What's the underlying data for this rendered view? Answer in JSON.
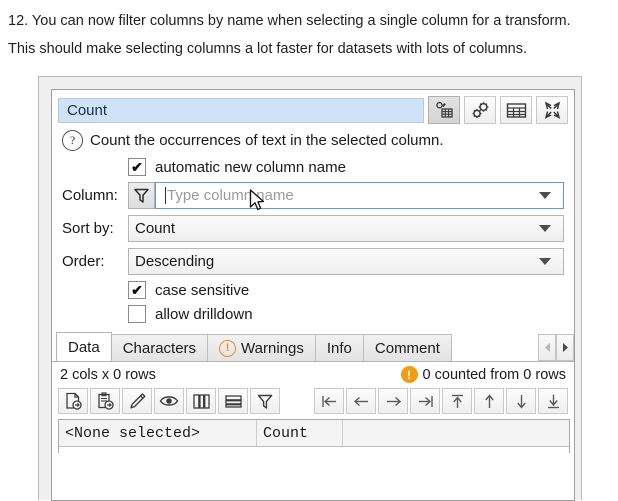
{
  "caption": {
    "line1": "12. You can now filter columns by name when selecting a single column for a transform.",
    "line2": "This should make selecting columns a lot faster for datasets with lots of columns."
  },
  "dialog": {
    "title": "Count",
    "toolbar": [
      {
        "name": "transform-settings-icon",
        "tooltip": "Transform settings",
        "pressed": true
      },
      {
        "name": "options-gears-icon",
        "tooltip": "Options",
        "pressed": false
      },
      {
        "name": "table-grid-icon",
        "tooltip": "Show table",
        "pressed": false
      },
      {
        "name": "expand-arrows-icon",
        "tooltip": "Maximize",
        "pressed": false
      }
    ],
    "description": "Count the occurrences of text in the selected column.",
    "help_icon": "?",
    "automatic_new_column_name": {
      "label": "automatic new column name",
      "checked": true,
      "check_glyph": "✔"
    },
    "column": {
      "label": "Column:",
      "filter_icon": "funnel-filter-icon",
      "placeholder": "Type column name",
      "value": ""
    },
    "sort_by": {
      "label": "Sort by:",
      "value": "Count"
    },
    "order": {
      "label": "Order:",
      "value": "Descending"
    },
    "case_sensitive": {
      "label": "case sensitive",
      "checked": true,
      "check_glyph": "✔"
    },
    "allow_drilldown": {
      "label": "allow drilldown",
      "checked": false,
      "check_glyph": ""
    },
    "tabs": [
      {
        "label": "Data",
        "active": true,
        "icon": ""
      },
      {
        "label": "Characters",
        "active": false,
        "icon": ""
      },
      {
        "label": "Warnings",
        "active": false,
        "icon": "warning-circle-icon"
      },
      {
        "label": "Info",
        "active": false,
        "icon": ""
      },
      {
        "label": "Comment",
        "active": false,
        "icon": ""
      }
    ],
    "tab_nav": {
      "prev": "◂",
      "next": "▸"
    },
    "status": {
      "dimensions": "2 cols x 0 rows",
      "warning_glyph": "!",
      "message": "0 counted from 0 rows",
      "warning_color": "#f49a13"
    },
    "left_tools": [
      {
        "name": "export-file-icon",
        "tooltip": "Export to file"
      },
      {
        "name": "copy-clipboard-icon",
        "tooltip": "Copy to clipboard"
      },
      {
        "name": "edit-pencil-icon",
        "tooltip": "Edit"
      },
      {
        "name": "view-eye-icon",
        "tooltip": "View"
      },
      {
        "name": "columns-icon",
        "tooltip": "Columns"
      },
      {
        "name": "rows-icon",
        "tooltip": "Rows"
      },
      {
        "name": "filter-funnel-icon",
        "tooltip": "Filter"
      }
    ],
    "nav_tools": [
      {
        "name": "first-record-icon",
        "tooltip": "First"
      },
      {
        "name": "previous-record-icon",
        "tooltip": "Previous"
      },
      {
        "name": "next-record-icon",
        "tooltip": "Next"
      },
      {
        "name": "last-record-icon",
        "tooltip": "Last"
      },
      {
        "name": "top-record-icon",
        "tooltip": "Top"
      },
      {
        "name": "up-record-icon",
        "tooltip": "Up"
      },
      {
        "name": "down-record-icon",
        "tooltip": "Down"
      },
      {
        "name": "bottom-record-icon",
        "tooltip": "Bottom"
      }
    ],
    "grid": {
      "headers": [
        "<None selected>",
        "Count",
        ""
      ]
    }
  },
  "colors": {
    "title_background": "#cfe2f6",
    "accent_warning": "#f49a13",
    "focus_border": "#5a9fd4"
  }
}
